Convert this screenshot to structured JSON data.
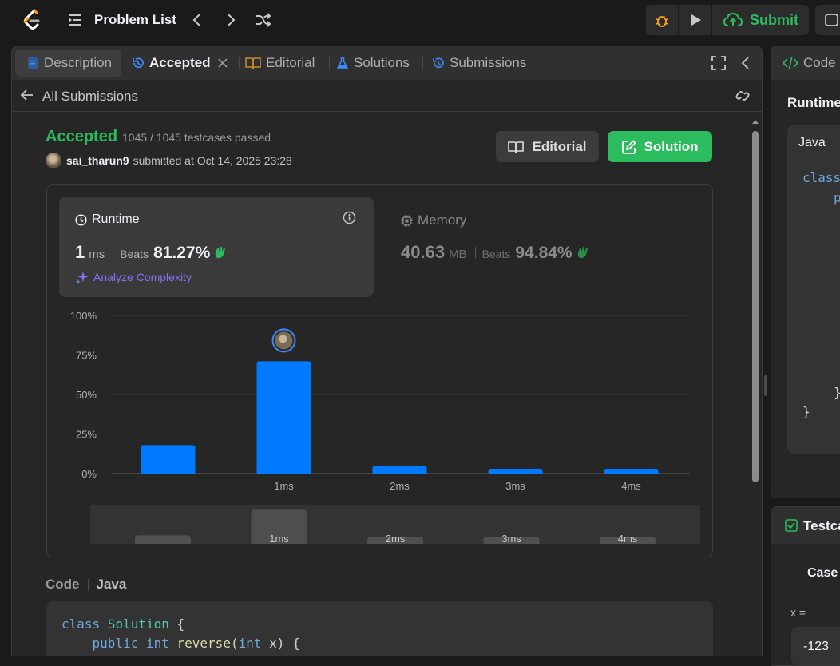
{
  "topbar": {
    "problem_list_label": "Problem List",
    "submit_label": "Submit"
  },
  "tabs": {
    "description": "Description",
    "accepted": "Accepted",
    "editorial": "Editorial",
    "solutions": "Solutions",
    "submissions": "Submissions"
  },
  "back_label": "All Submissions",
  "submission": {
    "status": "Accepted",
    "testcases": "1045 / 1045 testcases passed",
    "username": "sai_tharun9",
    "submitted_text": "submitted at Oct 14, 2025 23:28",
    "editorial_button": "Editorial",
    "solution_button": "Solution"
  },
  "runtime": {
    "title": "Runtime",
    "value": "1",
    "unit": "ms",
    "beats_label": "Beats",
    "beats_pct": "81.27%",
    "analyze_label": "Analyze Complexity"
  },
  "memory": {
    "title": "Memory",
    "value": "40.63",
    "unit": "MB",
    "beats_label": "Beats",
    "beats_pct": "94.84%"
  },
  "chart_data": {
    "type": "bar",
    "categories": [
      "",
      "1ms",
      "2ms",
      "3ms",
      "4ms"
    ],
    "values": [
      18,
      71,
      5,
      3,
      3
    ],
    "y_ticks": [
      "0%",
      "25%",
      "50%",
      "75%",
      "100%"
    ],
    "ylim": [
      0,
      100
    ],
    "grid": true,
    "highlight_category": "1ms",
    "range_selector": {
      "labels": [
        "",
        "1ms",
        "2ms",
        "3ms",
        "4ms"
      ],
      "heights": [
        18,
        71,
        5,
        3,
        3
      ],
      "selected": "1ms"
    }
  },
  "code": {
    "label": "Code",
    "language": "Java",
    "line1_kw": "class",
    "line1_cls": "Solution",
    "line1_rest": " {",
    "line2_kw1": "public",
    "line2_kw2": "int",
    "line2_fn": "reverse",
    "line2_kw3": "int",
    "line2_rest": " x) {"
  },
  "right_panel": {
    "code_tab": "Code",
    "runtime_label": "Runtime",
    "language": "Java",
    "code_keyword": "class",
    "code_p": "p",
    "close_brace_inner": "}",
    "close_brace_outer": "}",
    "testcase_tab": "Testcase",
    "case_label": "Case",
    "x_label": "x =",
    "x_value": "-123"
  },
  "colors": {
    "accent_green": "#2cbb5d",
    "bar_blue": "#007aff",
    "purple": "#8b6ff5"
  }
}
